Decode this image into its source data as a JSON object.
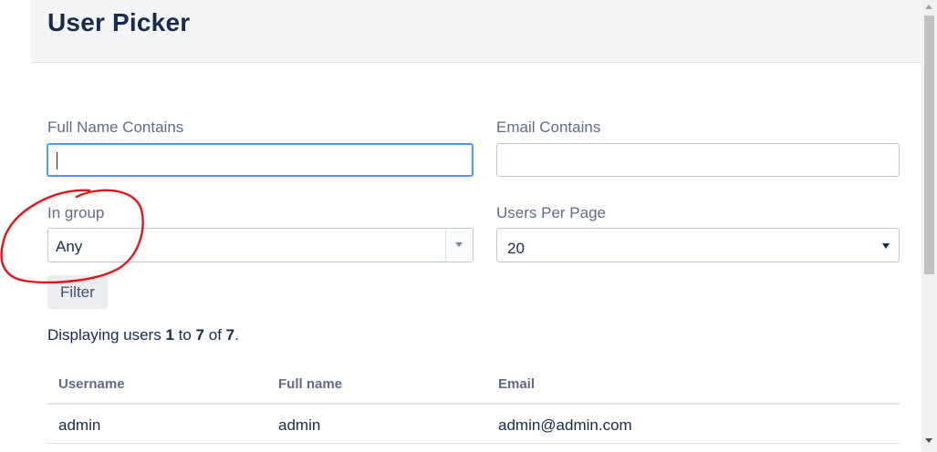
{
  "header": {
    "title": "User Picker"
  },
  "filters": {
    "full_name": {
      "label": "Full Name Contains",
      "value": ""
    },
    "email": {
      "label": "Email Contains",
      "value": ""
    },
    "group": {
      "label": "In group",
      "selected": "Any"
    },
    "per_page": {
      "label": "Users Per Page",
      "selected": "20"
    },
    "filter_button": "Filter"
  },
  "summary": {
    "prefix": "Displaying users ",
    "from": "1",
    "to_word": " to ",
    "to": "7",
    "of_word": " of ",
    "total": "7",
    "suffix": "."
  },
  "table": {
    "columns": [
      "Username",
      "Full name",
      "Email"
    ],
    "rows": [
      {
        "username": "admin",
        "full_name": "admin",
        "email": "admin@admin.com"
      }
    ]
  },
  "colors": {
    "annotation": "#e0141a",
    "focus_border": "#4c9aff",
    "header_bg": "#f4f5f7"
  },
  "icons": {
    "group_dropdown": "chevron-down-icon",
    "per_page_dropdown": "triangle-down-icon"
  }
}
